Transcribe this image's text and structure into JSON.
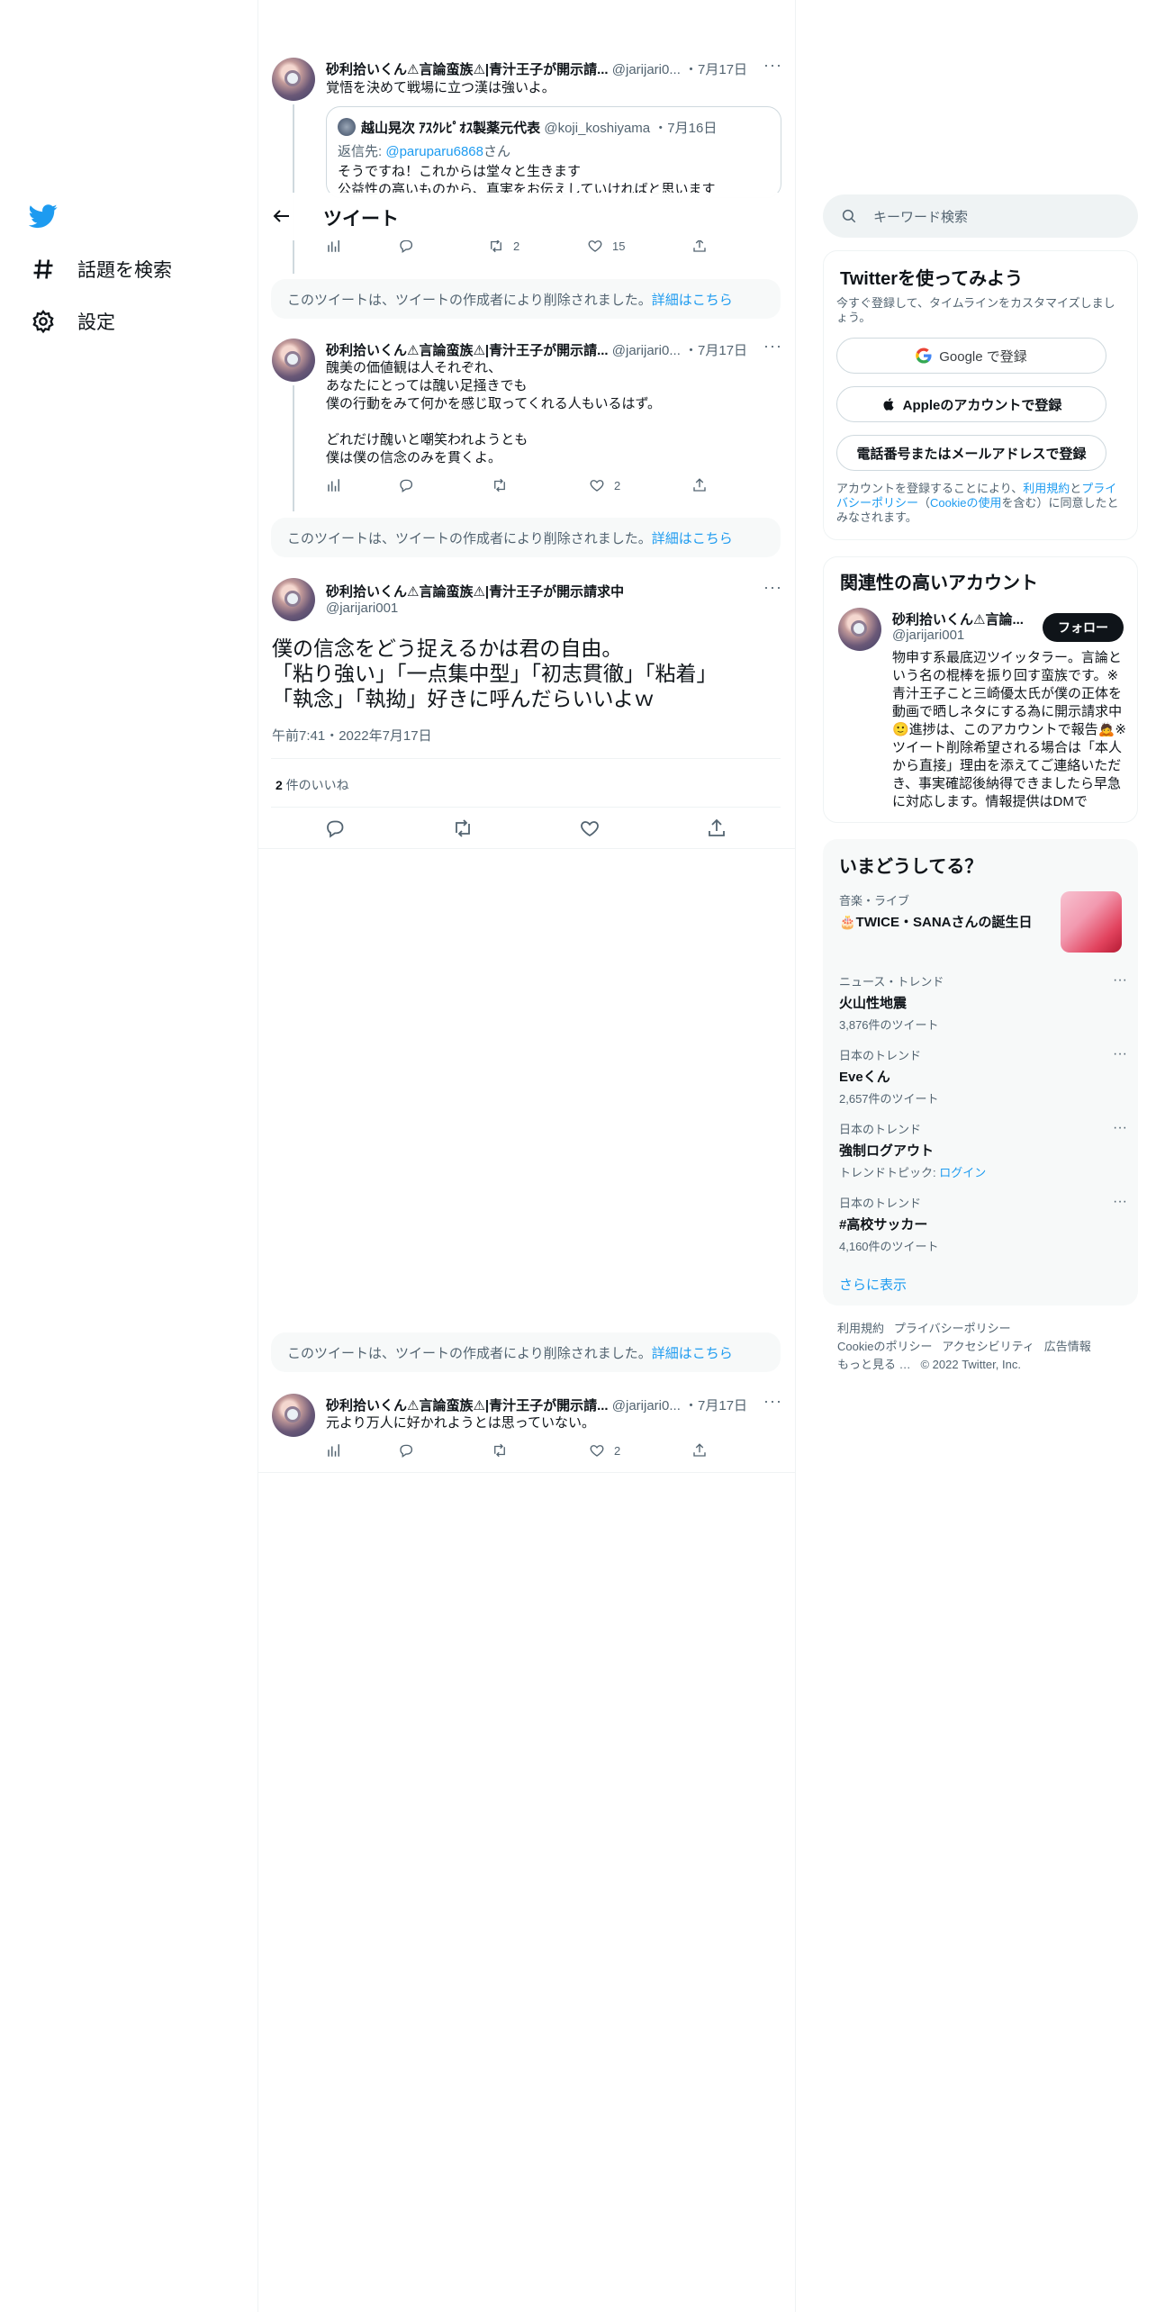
{
  "nav": {
    "logo": "twitter-bird-icon",
    "explore_label": "話題を検索",
    "settings_label": "設定"
  },
  "header": {
    "title": "ツイート"
  },
  "tweet1": {
    "name": "砂利拾いくん⚠言論蛮族⚠|青汁王子が開示請...",
    "handle": "@jarijari0...",
    "date": "・7月17日",
    "text": "覚悟を決めて戦場に立つ漢は強いよ。",
    "quote": {
      "name": "越山晃次 ｱｽｸﾚﾋﾟｵｽ製薬元代表",
      "handle": "@koji_koshiyama",
      "date": "・7月16日",
      "reply_to_label": "返信先: ",
      "reply_to_handle": "@paruparu6868",
      "reply_to_suffix": "さん",
      "text": "そうですね！これからは堂々と生きます\n公益性の高いものから、真実をお伝えしていければと思います"
    },
    "retweets": "2",
    "likes": "15"
  },
  "deleted_notice": {
    "text": "このツイートは、ツイートの作成者により削除されました。",
    "link": "詳細はこちら"
  },
  "tweet2": {
    "name": "砂利拾いくん⚠言論蛮族⚠|青汁王子が開示請...",
    "handle": "@jarijari0...",
    "date": "・7月17日",
    "text": "醜美の価値観は人それぞれ、\nあなたにとっては醜い足掻きでも\n僕の行動をみて何かを感じ取ってくれる人もいるはず。\n\nどれだけ醜いと嘲笑われようとも\n僕は僕の信念のみを貫くよ。",
    "likes": "2"
  },
  "main_tweet": {
    "name": "砂利拾いくん⚠言論蛮族⚠|青汁王子が開示請求中",
    "handle": "@jarijari001",
    "text": "僕の信念をどう捉えるかは君の自由。\n「粘り強い」「一点集中型」「初志貫徹」「粘着」\n「執念」「執拗」好きに呼んだらいいよｗ",
    "timestamp": "午前7:41・2022年7月17日",
    "likes_count": "2",
    "likes_label": " 件のいいね"
  },
  "tweet3": {
    "name": "砂利拾いくん⚠言論蛮族⚠|青汁王子が開示請...",
    "handle": "@jarijari0...",
    "date": "・7月17日",
    "text": "元より万人に好かれようとは思っていない。",
    "likes": "2"
  },
  "search": {
    "placeholder": "キーワード検索"
  },
  "signup": {
    "title": "Twitterを使ってみよう",
    "subtitle": "今すぐ登録して、タイムラインをカスタマイズしましょう。",
    "google_label": "Google で登録",
    "apple_label": "Appleのアカウントで登録",
    "phone_label": "電話番号またはメールアドレスで登録",
    "terms_1": "アカウントを登録することにより、",
    "terms_link_1": "利用規約",
    "terms_2": "と",
    "terms_link_2": "プライバシーポリシー",
    "terms_3": "（",
    "terms_link_3": "Cookieの使用",
    "terms_4": "を含む）に同意したとみなされます。"
  },
  "related": {
    "title": "関連性の高いアカウント",
    "name": "砂利拾いくん⚠言論...",
    "handle": "@jarijari001",
    "follow_label": "フォロー",
    "bio": "物申す系最底辺ツイッタラー。言論という名の棍棒を振り回す蛮族です。※青汁王子こと三崎優太氏が僕の正体を動画で晒しネタにする為に開示請求中🙂進捗は、このアカウントで報告🙇※ツイート削除希望される場合は「本人から直接」理由を添えてご連絡いただき、事実確認後納得できましたら早急に対応します。情報提供はDMで"
  },
  "trends": {
    "title": "いまどうしてる？",
    "items": [
      {
        "category": "音楽・ライブ",
        "title": "🎂TWICE・SANAさんの誕生日",
        "count": ""
      },
      {
        "category": "ニュース・トレンド",
        "title": "火山性地震",
        "count": "3,876件のツイート"
      },
      {
        "category": "日本のトレンド",
        "title": "Eveくん",
        "count": "2,657件のツイート"
      },
      {
        "category": "日本のトレンド",
        "title": "強制ログアウト",
        "count": "トレンドトピック: ",
        "count_link": "ログイン"
      },
      {
        "category": "日本のトレンド",
        "title": "#高校サッカー",
        "count": "4,160件のツイート"
      }
    ],
    "show_more": "さらに表示"
  },
  "footer": {
    "links": [
      "利用規約",
      "プライバシーポリシー",
      "Cookieのポリシー",
      "アクセシビリティ",
      "広告情報",
      "もっと見る …"
    ],
    "copyright": "© 2022 Twitter, Inc."
  }
}
